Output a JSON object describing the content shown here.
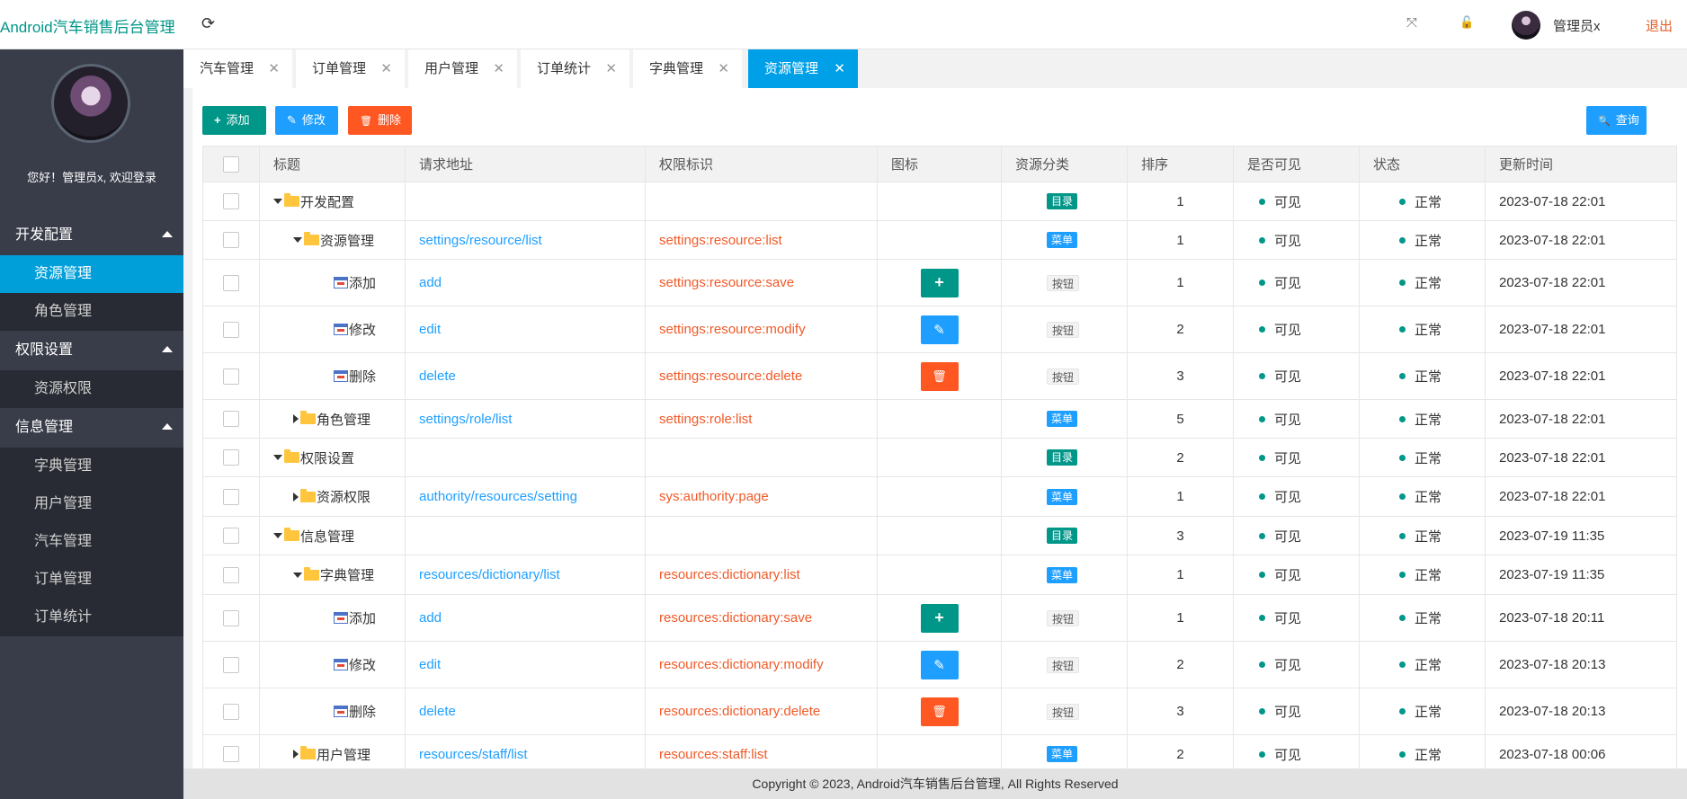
{
  "header": {
    "app_title": "Android汽车销售后台管理",
    "refresh_icon": "⟳",
    "fullscreen_icon": "⤧",
    "lock_icon": "🔓",
    "admin_name": "管理员x",
    "logout": "退出"
  },
  "sidebar": {
    "welcome": "您好！管理员x, 欢迎登录",
    "groups": [
      {
        "label": "开发配置",
        "items": [
          "资源管理",
          "角色管理"
        ]
      },
      {
        "label": "权限设置",
        "items": [
          "资源权限"
        ]
      },
      {
        "label": "信息管理",
        "items": [
          "字典管理",
          "用户管理",
          "汽车管理",
          "订单管理",
          "订单统计"
        ]
      }
    ],
    "active_item": "资源管理"
  },
  "tabs": [
    "汽车管理",
    "订单管理",
    "用户管理",
    "订单统计",
    "字典管理",
    "资源管理"
  ],
  "tab_close": "✕",
  "toolbar": {
    "add": "添加",
    "edit": "修改",
    "delete": "删除",
    "query": "查询",
    "add_icon": "+",
    "edit_icon": "✎",
    "delete_icon": "🗑",
    "query_icon": "🔍"
  },
  "table": {
    "headers": [
      "标题",
      "请求地址",
      "权限标识",
      "图标",
      "资源分类",
      "排序",
      "是否可见",
      "状态",
      "更新时间"
    ],
    "rows": [
      {
        "title": "开发配置",
        "url": "",
        "perm": "",
        "icon": "",
        "type": "目录",
        "order": "1",
        "visible": "可见",
        "status": "正常",
        "time": "2023-07-18 22:01"
      },
      {
        "title": "资源管理",
        "url": "settings/resource/list",
        "perm": "settings:resource:list",
        "icon": "",
        "type": "菜单",
        "order": "1",
        "visible": "可见",
        "status": "正常",
        "time": "2023-07-18 22:01"
      },
      {
        "title": "添加",
        "url": "add",
        "perm": "settings:resource:save",
        "icon": "+",
        "type": "按钮",
        "order": "1",
        "visible": "可见",
        "status": "正常",
        "time": "2023-07-18 22:01"
      },
      {
        "title": "修改",
        "url": "edit",
        "perm": "settings:resource:modify",
        "icon": "✎",
        "type": "按钮",
        "order": "2",
        "visible": "可见",
        "status": "正常",
        "time": "2023-07-18 22:01"
      },
      {
        "title": "删除",
        "url": "delete",
        "perm": "settings:resource:delete",
        "icon": "🗑",
        "type": "按钮",
        "order": "3",
        "visible": "可见",
        "status": "正常",
        "time": "2023-07-18 22:01"
      },
      {
        "title": "角色管理",
        "url": "settings/role/list",
        "perm": "settings:role:list",
        "icon": "",
        "type": "菜单",
        "order": "5",
        "visible": "可见",
        "status": "正常",
        "time": "2023-07-18 22:01"
      },
      {
        "title": "权限设置",
        "url": "",
        "perm": "",
        "icon": "",
        "type": "目录",
        "order": "2",
        "visible": "可见",
        "status": "正常",
        "time": "2023-07-18 22:01"
      },
      {
        "title": "资源权限",
        "url": "authority/resources/setting",
        "perm": "sys:authority:page",
        "icon": "",
        "type": "菜单",
        "order": "1",
        "visible": "可见",
        "status": "正常",
        "time": "2023-07-18 22:01"
      },
      {
        "title": "信息管理",
        "url": "",
        "perm": "",
        "icon": "",
        "type": "目录",
        "order": "3",
        "visible": "可见",
        "status": "正常",
        "time": "2023-07-19 11:35"
      },
      {
        "title": "字典管理",
        "url": "resources/dictionary/list",
        "perm": "resources:dictionary:list",
        "icon": "",
        "type": "菜单",
        "order": "1",
        "visible": "可见",
        "status": "正常",
        "time": "2023-07-19 11:35"
      },
      {
        "title": "添加",
        "url": "add",
        "perm": "resources:dictionary:save",
        "icon": "+",
        "type": "按钮",
        "order": "1",
        "visible": "可见",
        "status": "正常",
        "time": "2023-07-18 20:11"
      },
      {
        "title": "修改",
        "url": "edit",
        "perm": "resources:dictionary:modify",
        "icon": "✎",
        "type": "按钮",
        "order": "2",
        "visible": "可见",
        "status": "正常",
        "time": "2023-07-18 20:13"
      },
      {
        "title": "删除",
        "url": "delete",
        "perm": "resources:dictionary:delete",
        "icon": "🗑",
        "type": "按钮",
        "order": "3",
        "visible": "可见",
        "status": "正常",
        "time": "2023-07-18 20:13"
      },
      {
        "title": "用户管理",
        "url": "resources/staff/list",
        "perm": "resources:staff:list",
        "icon": "",
        "type": "菜单",
        "order": "2",
        "visible": "可见",
        "status": "正常",
        "time": "2023-07-18 00:06"
      }
    ]
  },
  "footer": "Copyright © 2023, Android汽车销售后台管理, All Rights Reserved",
  "colors": {
    "accent": "#009688",
    "primary": "#1e9fff",
    "danger": "#ff5722",
    "tab_active": "#00a0e9",
    "logout": "#e4612b"
  }
}
